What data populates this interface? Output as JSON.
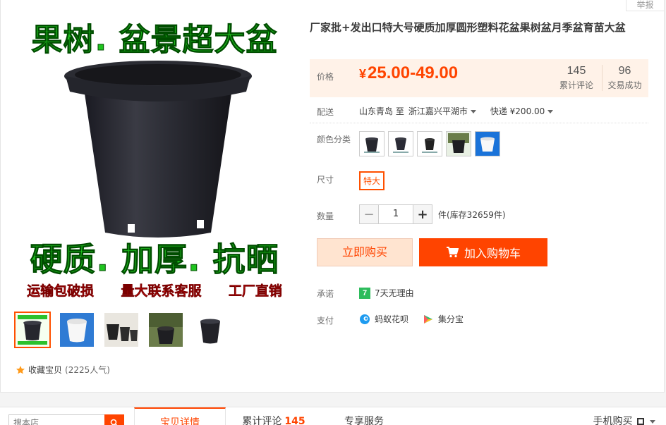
{
  "report_label": "举报",
  "main_image": {
    "caption_top": "果树. 盆景超大盆",
    "caption_mid": "硬质. 加厚. 抗晒",
    "caption_bottom": [
      "运输包破损",
      "量大联系客服",
      "工厂直销"
    ]
  },
  "thumbnails": [
    "black-pot-promo",
    "white-pot",
    "pot-set",
    "pot-in-use",
    "black-pot"
  ],
  "favorite": {
    "label": "收藏宝贝",
    "count": "(2225人气)"
  },
  "product": {
    "title": "厂家批+发出口特大号硬质加厚圆形塑料花盆果树盆月季盆育苗大盆",
    "price_label": "价格",
    "price_symbol": "¥",
    "price_range": "25.00-49.00",
    "reviews_count": "145",
    "reviews_label": "累计评论",
    "sales_count": "96",
    "sales_label": "交易成功"
  },
  "shipping": {
    "label": "配送",
    "from": "山东青岛 至",
    "to": "浙江嘉兴平湖市",
    "method": "快递 ¥200.00"
  },
  "color": {
    "label": "颜色分类"
  },
  "size": {
    "label": "尺寸",
    "option": "特大"
  },
  "quantity": {
    "label": "数量",
    "minus": "−",
    "value": "1",
    "plus": "+",
    "stock": "件(库存32659件)"
  },
  "actions": {
    "buy_now": "立即购买",
    "add_cart": "加入购物车"
  },
  "promise": {
    "label": "承诺",
    "badge": "7",
    "text": "7天无理由"
  },
  "payment": {
    "label": "支付",
    "huabei": "蚂蚁花呗",
    "jifenbao": "集分宝"
  },
  "bottom": {
    "search_placeholder": "搜本店",
    "tab_detail": "宝贝详情",
    "tab_reviews": "累计评论",
    "tab_reviews_count": "145",
    "tab_service": "专享服务",
    "mobile_buy": "手机购买"
  },
  "colors": {
    "accent": "#ff4400",
    "price_bg": "#fff2e8",
    "green_caption": "#1fc41f"
  }
}
